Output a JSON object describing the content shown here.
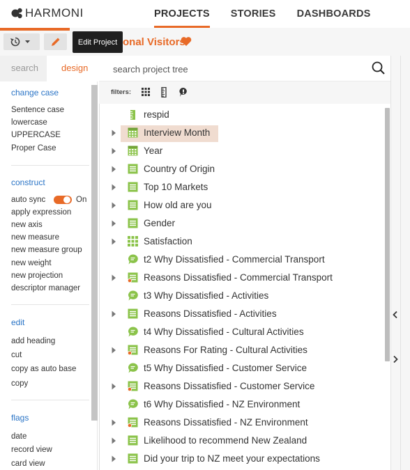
{
  "app": {
    "logo_text": "HARMONI"
  },
  "nav": {
    "tabs": [
      {
        "label": "PROJECTS"
      },
      {
        "label": "STORIES"
      },
      {
        "label": "DASHBOARDS"
      }
    ]
  },
  "toolbar": {
    "tooltip": "Edit Project",
    "project_title": "onal Visitors"
  },
  "left": {
    "tabs": {
      "search": "search",
      "design": "design"
    },
    "change_case": {
      "heading": "change case",
      "items": [
        "Sentence case",
        "lowercase",
        "UPPERCASE",
        "Proper Case"
      ]
    },
    "construct": {
      "heading": "construct",
      "auto_sync": "auto sync",
      "auto_sync_state": "On",
      "items": [
        "apply expression",
        "new axis",
        "new measure",
        "new measure group",
        "new weight",
        "new projection",
        "descriptor manager"
      ]
    },
    "edit": {
      "heading": "edit",
      "items": [
        "add heading",
        "cut",
        "copy as auto base",
        "copy"
      ]
    },
    "flags": {
      "heading": "flags",
      "items": [
        "date",
        "record view",
        "card view"
      ]
    }
  },
  "search": {
    "placeholder": "search project tree"
  },
  "filters": {
    "label": "filters:"
  },
  "tree": {
    "rows": [
      {
        "label": "respid",
        "icon": "ruler-icon",
        "expandable": false
      },
      {
        "label": "Interview Month",
        "icon": "calendar-icon",
        "expandable": true,
        "selected": true
      },
      {
        "label": "Year",
        "icon": "calendar-icon",
        "expandable": true
      },
      {
        "label": "Country of Origin",
        "icon": "list-icon",
        "expandable": true
      },
      {
        "label": "Top 10 Markets",
        "icon": "list-icon",
        "expandable": true
      },
      {
        "label": "How old are you",
        "icon": "list-icon",
        "expandable": true
      },
      {
        "label": "Gender",
        "icon": "list-icon",
        "expandable": true
      },
      {
        "label": "Satisfaction",
        "icon": "grid-icon",
        "expandable": true
      },
      {
        "label": "t2 Why Dissatisfied - Commercial Transport",
        "icon": "comment-icon",
        "expandable": false
      },
      {
        "label": "Reasons Dissatisfied - Commercial Transport",
        "icon": "list-flag-icon",
        "expandable": true
      },
      {
        "label": "t3 Why Dissatisfied - Activities",
        "icon": "comment-icon",
        "expandable": false
      },
      {
        "label": "Reasons Dissatisfied - Activities",
        "icon": "list-icon",
        "expandable": true
      },
      {
        "label": "t4 Why Dissatisfied - Cultural Activities",
        "icon": "comment-icon",
        "expandable": false
      },
      {
        "label": "Reasons For Rating - Cultural Activities",
        "icon": "list-flag-icon",
        "expandable": true
      },
      {
        "label": "t5 Why Dissatisfied - Customer Service",
        "icon": "comment-icon",
        "expandable": false
      },
      {
        "label": "Reasons Dissatisfied - Customer Service",
        "icon": "list-flag-icon",
        "expandable": true
      },
      {
        "label": "t6 Why Dissatisfied - NZ Environment",
        "icon": "comment-icon",
        "expandable": false
      },
      {
        "label": "Reasons Dissatisfied - NZ Environment",
        "icon": "list-flag-icon",
        "expandable": true
      },
      {
        "label": "Likelihood to recommend New Zealand",
        "icon": "list-icon",
        "expandable": true
      },
      {
        "label": "Did your trip to NZ meet your expectations",
        "icon": "list-icon",
        "expandable": true
      }
    ]
  },
  "colors": {
    "accent": "#e86a27",
    "link": "#2a74c6",
    "icon_green": "#8bc34a"
  }
}
